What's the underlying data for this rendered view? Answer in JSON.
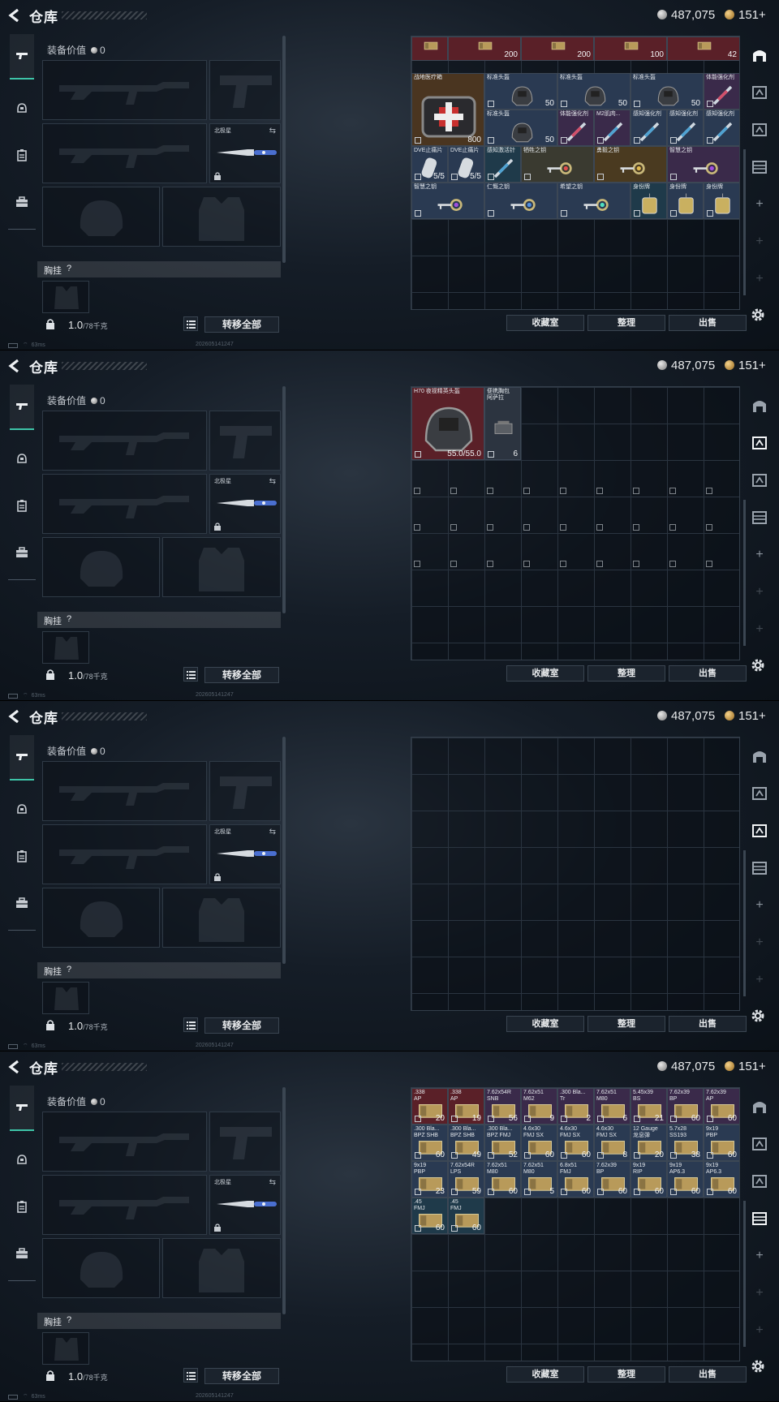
{
  "header": {
    "title": "仓库",
    "currency_a": "487,075",
    "currency_b": "151+"
  },
  "equipment": {
    "value_label": "装备价值",
    "value": "0",
    "melee_name": "北极星",
    "vest_label": "胸挂",
    "vest_help": "?",
    "weight": "1.0",
    "weight_max": "/78千克",
    "transfer_all": "转移全部"
  },
  "status": {
    "ping": "63ms",
    "stamp": "202605141247"
  },
  "storage_buttons": [
    "收藏室",
    "整理",
    "出售"
  ],
  "panels": [
    {
      "active_tab": 0,
      "items": [
        {
          "name": "",
          "count": "",
          "col": 0,
          "row": 0,
          "w": 1,
          "h": 1,
          "color": "#5a2028",
          "partial": true
        },
        {
          "name": "",
          "count": "200",
          "col": 1,
          "row": 0,
          "w": 2,
          "h": 1,
          "color": "#5a2028",
          "partial": true
        },
        {
          "name": "",
          "count": "200",
          "col": 3,
          "row": 0,
          "w": 2,
          "h": 1,
          "color": "#5a2028",
          "partial": true
        },
        {
          "name": "",
          "count": "100",
          "col": 5,
          "row": 0,
          "w": 2,
          "h": 1,
          "color": "#5a2028",
          "partial": true
        },
        {
          "name": "",
          "count": "42",
          "col": 7,
          "row": 0,
          "w": 2,
          "h": 1,
          "color": "#5a2028",
          "partial": true
        },
        {
          "name": "战地医疗箱",
          "count": "800",
          "col": 0,
          "row": 1,
          "w": 2,
          "h": 2,
          "color": "#4a3520"
        },
        {
          "name": "标准头盔",
          "count": "50",
          "col": 2,
          "row": 1,
          "w": 2,
          "h": 1,
          "color": "#2a3a52"
        },
        {
          "name": "标准头盔",
          "count": "50",
          "col": 4,
          "row": 1,
          "w": 2,
          "h": 1,
          "color": "#2a3a52"
        },
        {
          "name": "标准头盔",
          "count": "50",
          "col": 6,
          "row": 1,
          "w": 2,
          "h": 1,
          "color": "#2a3a52"
        },
        {
          "name": "体能强化剂",
          "count": "",
          "col": 8,
          "row": 1,
          "w": 1,
          "h": 1,
          "color": "#3a2a4a"
        },
        {
          "name": "标准头盔",
          "count": "50",
          "col": 2,
          "row": 2,
          "w": 2,
          "h": 1,
          "color": "#2a3a52"
        },
        {
          "name": "体能强化剂",
          "count": "",
          "col": 4,
          "row": 2,
          "w": 1,
          "h": 1,
          "color": "#3a2a4a"
        },
        {
          "name": "M2肌肉...",
          "count": "",
          "col": 5,
          "row": 2,
          "w": 1,
          "h": 1,
          "color": "#3a2a4a"
        },
        {
          "name": "感知强化剂",
          "count": "",
          "col": 6,
          "row": 2,
          "w": 1,
          "h": 1,
          "color": "#2a3a52"
        },
        {
          "name": "感知强化剂",
          "count": "",
          "col": 7,
          "row": 2,
          "w": 1,
          "h": 1,
          "color": "#2a3a52"
        },
        {
          "name": "感知强化剂",
          "count": "",
          "col": 8,
          "row": 2,
          "w": 1,
          "h": 1,
          "color": "#2a3a52"
        },
        {
          "name": "DVE止痛片",
          "count": "5/5",
          "col": 0,
          "row": 3,
          "w": 1,
          "h": 1,
          "color": "#2a3a52"
        },
        {
          "name": "DVE止痛片",
          "count": "5/5",
          "col": 1,
          "row": 3,
          "w": 1,
          "h": 1,
          "color": "#2a3a52"
        },
        {
          "name": "感知激活针",
          "count": "",
          "col": 2,
          "row": 3,
          "w": 1,
          "h": 1,
          "color": "#1f3a4a"
        },
        {
          "name": "牺牲之钥",
          "count": "",
          "col": 3,
          "row": 3,
          "w": 2,
          "h": 1,
          "color": "#3a3a30"
        },
        {
          "name": "勇毅之钥",
          "count": "",
          "col": 5,
          "row": 3,
          "w": 2,
          "h": 1,
          "color": "#4a3a20"
        },
        {
          "name": "智慧之钥",
          "count": "",
          "col": 7,
          "row": 3,
          "w": 2,
          "h": 1,
          "color": "#3a2a4a"
        },
        {
          "name": "智慧之钥",
          "count": "",
          "col": 0,
          "row": 4,
          "w": 2,
          "h": 1,
          "color": "#2a3a52"
        },
        {
          "name": "仁慨之钥",
          "count": "",
          "col": 2,
          "row": 4,
          "w": 2,
          "h": 1,
          "color": "#2a3a52"
        },
        {
          "name": "希望之钥",
          "count": "",
          "col": 4,
          "row": 4,
          "w": 2,
          "h": 1,
          "color": "#2a3a52"
        },
        {
          "name": "身份牌",
          "count": "",
          "col": 6,
          "row": 4,
          "w": 1,
          "h": 1,
          "color": "#1f3a4a"
        },
        {
          "name": "身份牌",
          "count": "",
          "col": 7,
          "row": 4,
          "w": 1,
          "h": 1,
          "color": "#2a3a52"
        },
        {
          "name": "身份牌",
          "count": "",
          "col": 8,
          "row": 4,
          "w": 1,
          "h": 1,
          "color": "#2a3a52"
        }
      ]
    },
    {
      "active_tab": 1,
      "items": [
        {
          "name": "H70 夜视精英头盔",
          "count": "55.0/55.0",
          "col": 0,
          "row": 0,
          "w": 2,
          "h": 2,
          "color": "#5a2028"
        },
        {
          "name": "便携胸包",
          "sub": "阿萨拉",
          "count": "6",
          "col": 2,
          "row": 0,
          "w": 1,
          "h": 2,
          "color": "#2c3440"
        }
      ]
    },
    {
      "active_tab": 2,
      "items": []
    },
    {
      "active_tab": 3,
      "items": [
        {
          "name": ".338",
          "sub": "AP",
          "count": "20",
          "col": 0,
          "row": 0,
          "w": 1,
          "h": 1,
          "color": "#5a2028"
        },
        {
          "name": ".338",
          "sub": "AP",
          "count": "19",
          "col": 1,
          "row": 0,
          "w": 1,
          "h": 1,
          "color": "#5a2028"
        },
        {
          "name": "7.62x54R",
          "sub": "SNB",
          "count": "56",
          "col": 2,
          "row": 0,
          "w": 1,
          "h": 1,
          "color": "#3a2a4a"
        },
        {
          "name": "7.62x51",
          "sub": "M62",
          "count": "9",
          "col": 3,
          "row": 0,
          "w": 1,
          "h": 1,
          "color": "#3a2a4a"
        },
        {
          "name": ".300 Bla...",
          "sub": "Tr",
          "count": "2",
          "col": 4,
          "row": 0,
          "w": 1,
          "h": 1,
          "color": "#3a2a4a"
        },
        {
          "name": "7.62x51",
          "sub": "M80",
          "count": "6",
          "col": 5,
          "row": 0,
          "w": 1,
          "h": 1,
          "color": "#3a2a4a"
        },
        {
          "name": "5.45x39",
          "sub": "BS",
          "count": "21",
          "col": 6,
          "row": 0,
          "w": 1,
          "h": 1,
          "color": "#3a2a4a"
        },
        {
          "name": "7.62x39",
          "sub": "BP",
          "count": "60",
          "col": 7,
          "row": 0,
          "w": 1,
          "h": 1,
          "color": "#3a2a4a"
        },
        {
          "name": "7.62x39",
          "sub": "AP",
          "count": "60",
          "col": 8,
          "row": 0,
          "w": 1,
          "h": 1,
          "color": "#3a2a4a"
        },
        {
          "name": ".300 Bla...",
          "sub": "BPZ SHB",
          "count": "60",
          "col": 0,
          "row": 1,
          "w": 1,
          "h": 1,
          "color": "#2a3a52"
        },
        {
          "name": ".300 Bla...",
          "sub": "BPZ SHB",
          "count": "49",
          "col": 1,
          "row": 1,
          "w": 1,
          "h": 1,
          "color": "#2a3a52"
        },
        {
          "name": ".300 Bla...",
          "sub": "BPZ FMJ",
          "count": "52",
          "col": 2,
          "row": 1,
          "w": 1,
          "h": 1,
          "color": "#2a3a52"
        },
        {
          "name": "4.6x30",
          "sub": "FMJ SX",
          "count": "60",
          "col": 3,
          "row": 1,
          "w": 1,
          "h": 1,
          "color": "#2a3a52"
        },
        {
          "name": "4.6x30",
          "sub": "FMJ SX",
          "count": "60",
          "col": 4,
          "row": 1,
          "w": 1,
          "h": 1,
          "color": "#2a3a52"
        },
        {
          "name": "4.6x30",
          "sub": "FMJ SX",
          "count": "8",
          "col": 5,
          "row": 1,
          "w": 1,
          "h": 1,
          "color": "#2a3a52"
        },
        {
          "name": "12 Gauge",
          "sub": "龙息弹",
          "count": "20",
          "col": 6,
          "row": 1,
          "w": 1,
          "h": 1,
          "color": "#2a3a52"
        },
        {
          "name": "5.7x28",
          "sub": "SS193",
          "count": "38",
          "col": 7,
          "row": 1,
          "w": 1,
          "h": 1,
          "color": "#2a3a52"
        },
        {
          "name": "9x19",
          "sub": "PBP",
          "count": "60",
          "col": 8,
          "row": 1,
          "w": 1,
          "h": 1,
          "color": "#2a3a52"
        },
        {
          "name": "9x19",
          "sub": "PBP",
          "count": "23",
          "col": 0,
          "row": 2,
          "w": 1,
          "h": 1,
          "color": "#2a3a52"
        },
        {
          "name": "7.62x54R",
          "sub": "LPS",
          "count": "59",
          "col": 1,
          "row": 2,
          "w": 1,
          "h": 1,
          "color": "#2a3a52"
        },
        {
          "name": "7.62x51",
          "sub": "M80",
          "count": "60",
          "col": 2,
          "row": 2,
          "w": 1,
          "h": 1,
          "color": "#2a3a52"
        },
        {
          "name": "7.62x51",
          "sub": "M80",
          "count": "5",
          "col": 3,
          "row": 2,
          "w": 1,
          "h": 1,
          "color": "#2a3a52"
        },
        {
          "name": "6.8x51",
          "sub": "FMJ",
          "count": "60",
          "col": 4,
          "row": 2,
          "w": 1,
          "h": 1,
          "color": "#2a3a52"
        },
        {
          "name": "7.62x39",
          "sub": "BP",
          "count": "60",
          "col": 5,
          "row": 2,
          "w": 1,
          "h": 1,
          "color": "#2a3a52"
        },
        {
          "name": "9x19",
          "sub": "RIP",
          "count": "60",
          "col": 6,
          "row": 2,
          "w": 1,
          "h": 1,
          "color": "#2a3a52"
        },
        {
          "name": "9x19",
          "sub": "AP6.3",
          "count": "60",
          "col": 7,
          "row": 2,
          "w": 1,
          "h": 1,
          "color": "#2a3a52"
        },
        {
          "name": "9x19",
          "sub": "AP6.3",
          "count": "60",
          "col": 8,
          "row": 2,
          "w": 1,
          "h": 1,
          "color": "#2a3a52"
        },
        {
          "name": ".45",
          "sub": "FMJ",
          "count": "60",
          "col": 0,
          "row": 3,
          "w": 1,
          "h": 1,
          "color": "#1f3a4a"
        },
        {
          "name": ".45",
          "sub": "FMJ",
          "count": "60",
          "col": 1,
          "row": 3,
          "w": 1,
          "h": 1,
          "color": "#1f3a4a"
        }
      ]
    }
  ]
}
